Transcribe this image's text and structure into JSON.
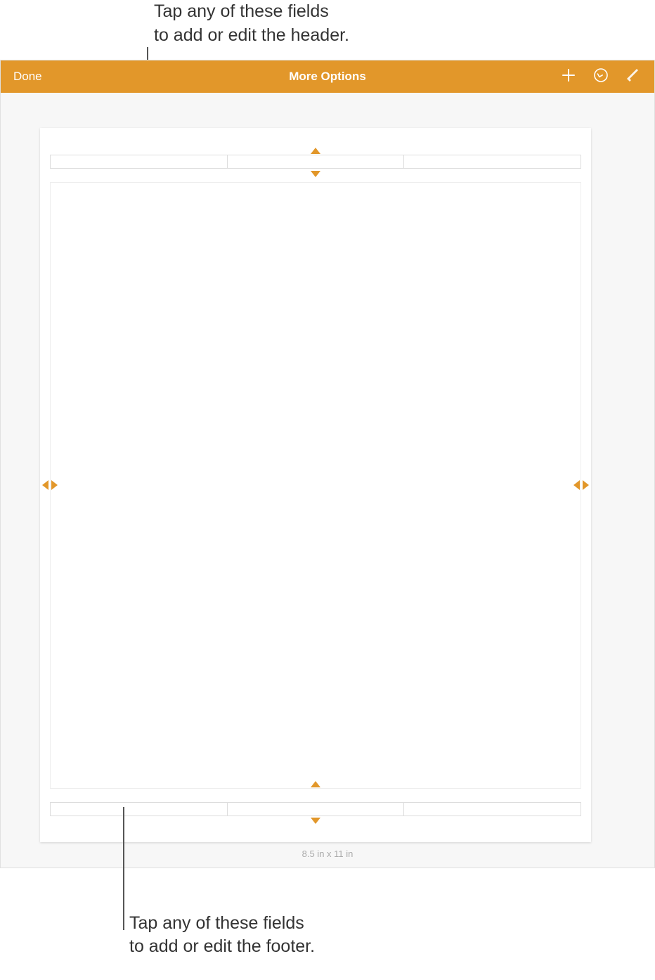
{
  "annotations": {
    "top_line1": "Tap any of these fields",
    "top_line2": "to add or edit the header.",
    "bottom_line1": "Tap any of these fields",
    "bottom_line2": "to add or edit the footer."
  },
  "toolbar": {
    "done_label": "Done",
    "title": "More Options",
    "icons": {
      "add": "plus-icon",
      "undo": "undo-icon",
      "brush": "brush-icon"
    }
  },
  "document": {
    "header_fields": [
      "",
      "",
      ""
    ],
    "footer_fields": [
      "",
      "",
      ""
    ],
    "page_size_label": "8.5 in x 11 in"
  },
  "colors": {
    "accent": "#e2972a"
  }
}
